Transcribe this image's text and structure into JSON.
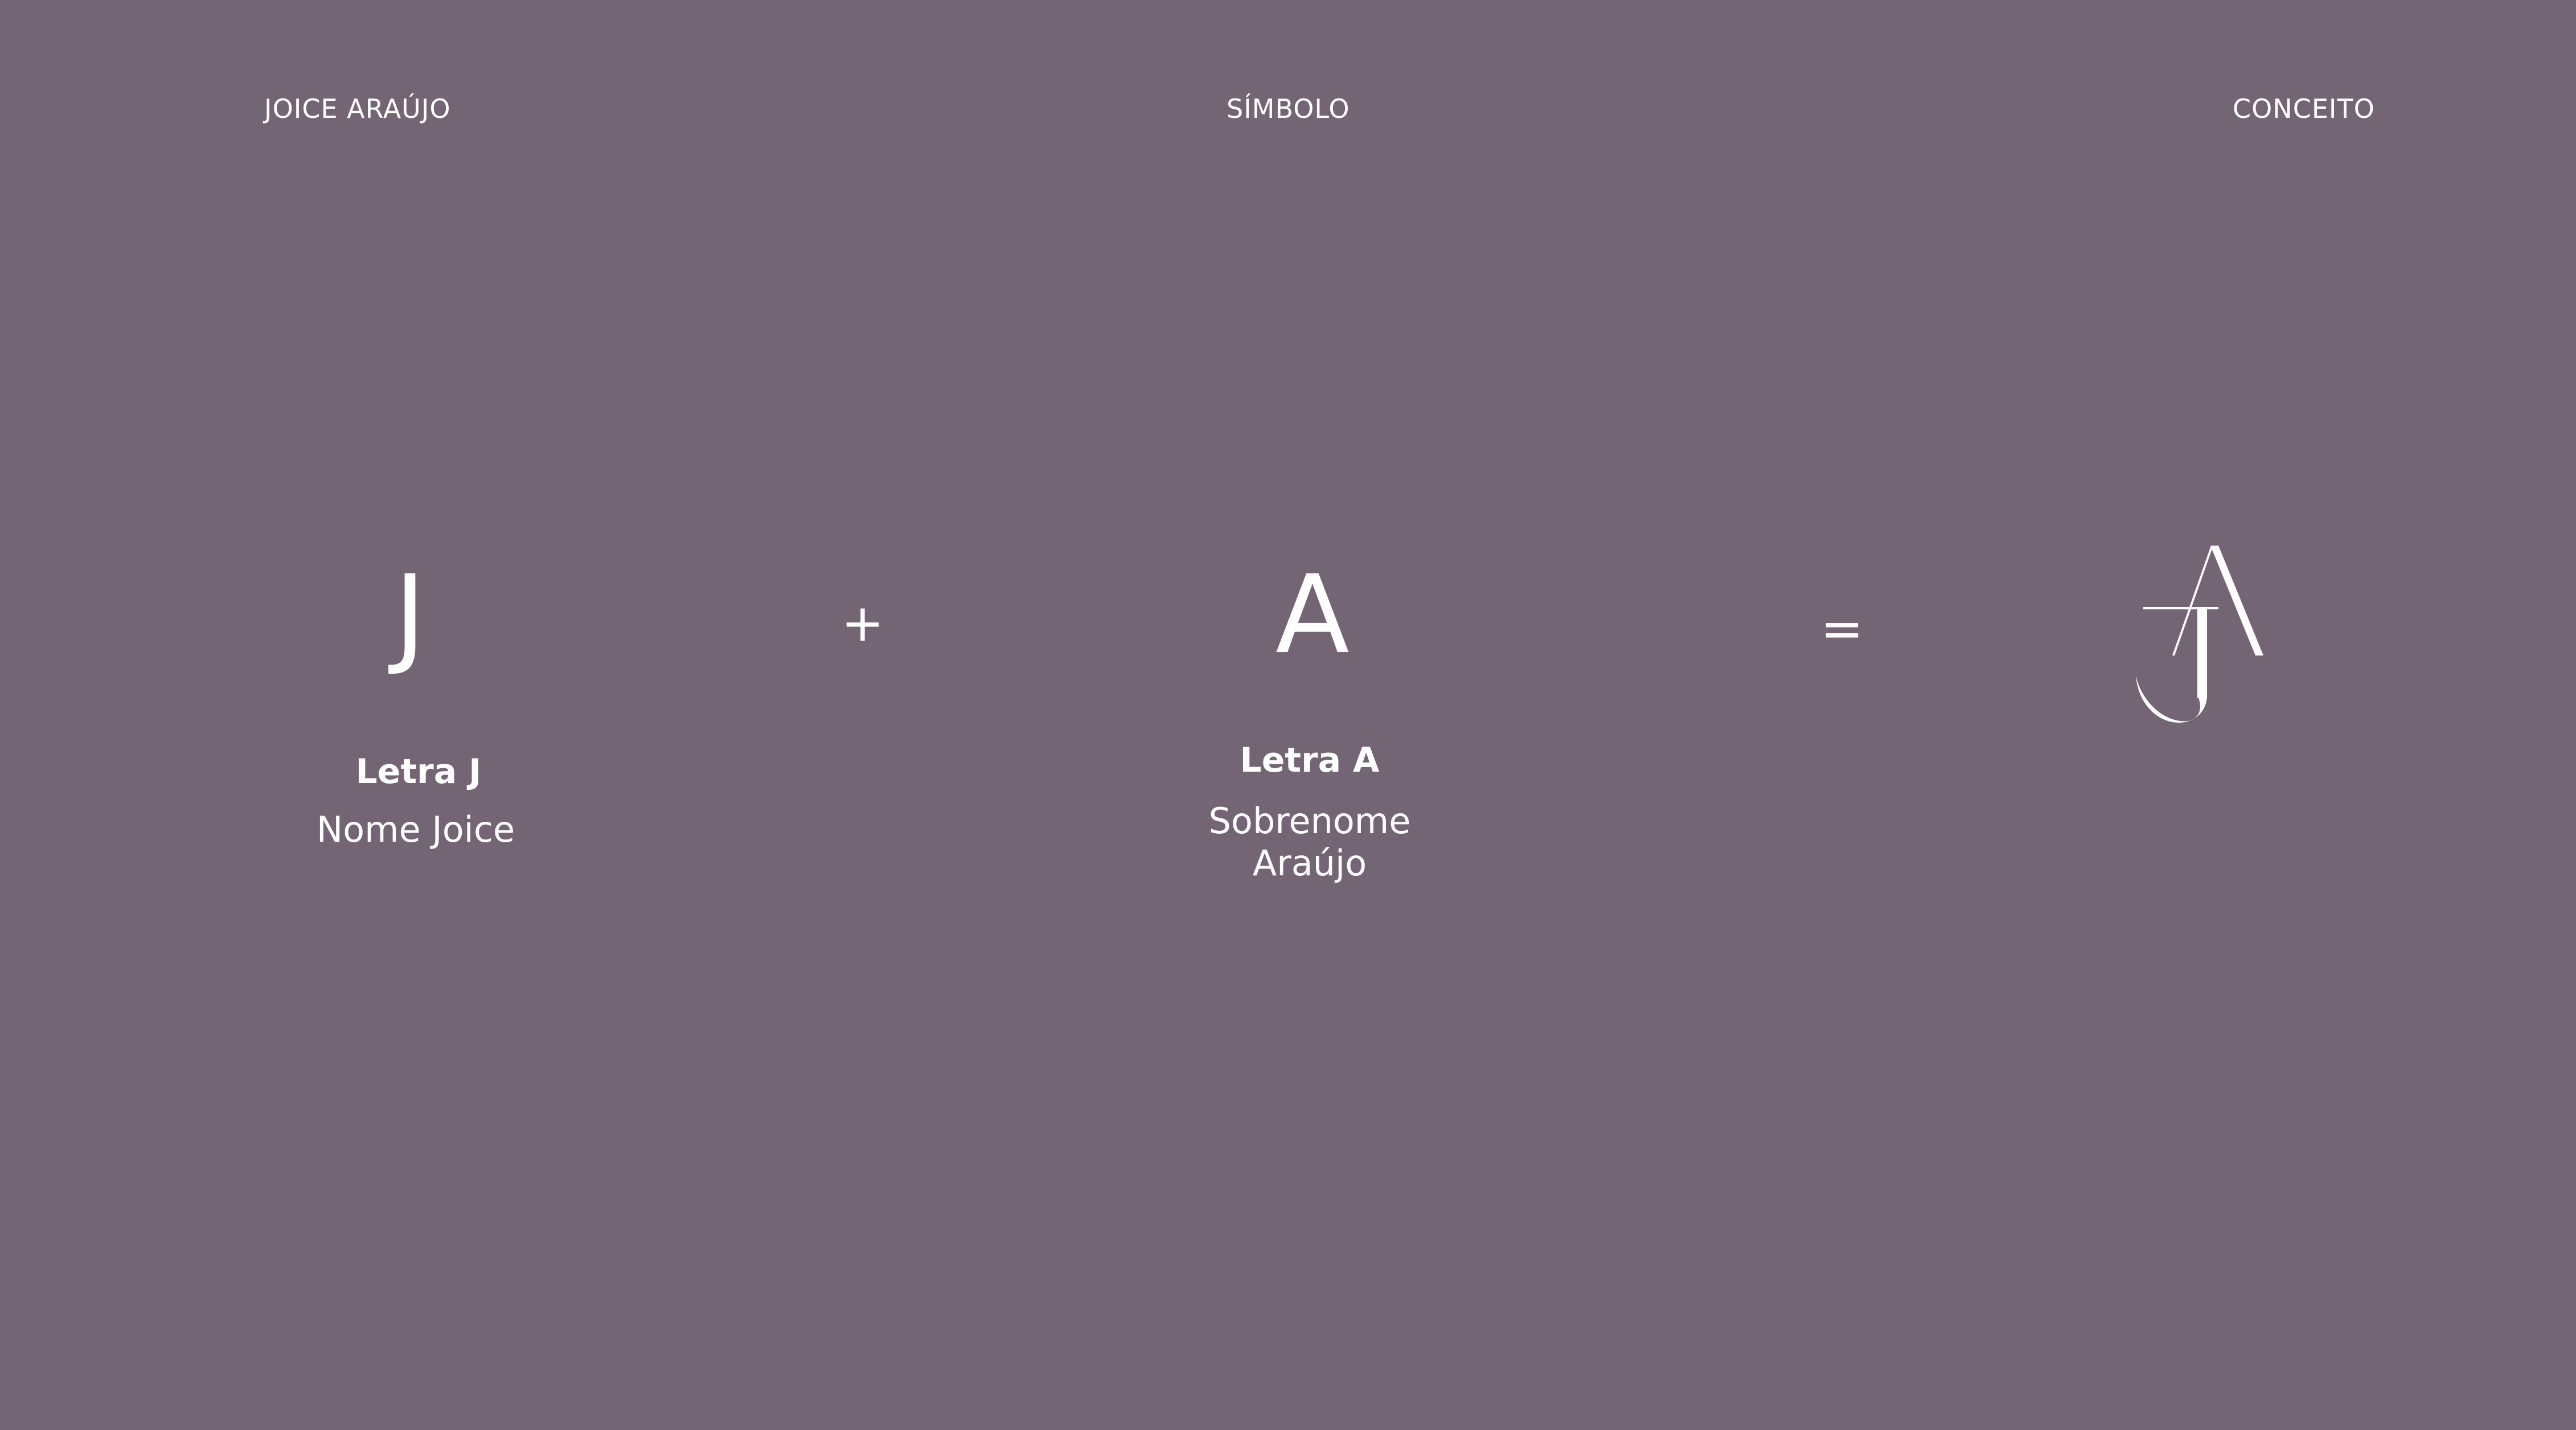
{
  "header": {
    "left": "JOICE ARAÚJO",
    "center": "SÍMBOLO",
    "right": "CONCEITO"
  },
  "equation": {
    "letter_j": "J",
    "plus": "+",
    "letter_a": "A",
    "equals": "=",
    "result_icon": "ja-monogram-icon"
  },
  "captions": {
    "j_title": "Letra J",
    "j_desc": "Nome Joice",
    "a_title": "Letra A",
    "a_desc_line1": "Sobrenome",
    "a_desc_line2": "Araújo"
  },
  "colors": {
    "background": "#736574",
    "foreground": "#ffffff"
  }
}
